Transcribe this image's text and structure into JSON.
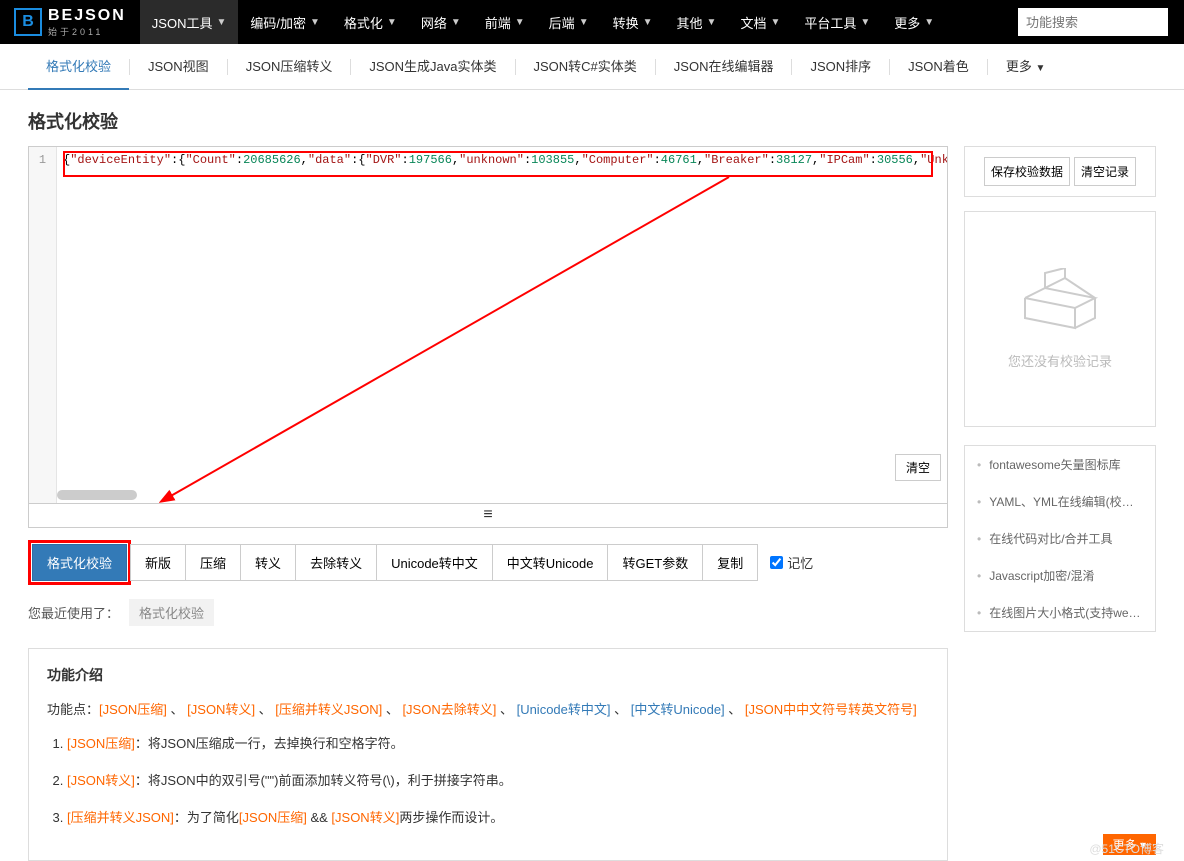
{
  "logo": {
    "letter": "B",
    "name": "BEJSON",
    "sub": "始于2011"
  },
  "nav": [
    "JSON工具",
    "编码/加密",
    "格式化",
    "网络",
    "前端",
    "后端",
    "转换",
    "其他",
    "文档",
    "平台工具",
    "更多"
  ],
  "search": {
    "placeholder": "功能搜索"
  },
  "subnav": [
    "格式化校验",
    "JSON视图",
    "JSON压缩转义",
    "JSON生成Java实体类",
    "JSON转C#实体类",
    "JSON在线编辑器",
    "JSON排序",
    "JSON着色",
    "更多"
  ],
  "title": "格式化校验",
  "editor": {
    "line": "1",
    "code": {
      "t1": "{",
      "k1": "\"deviceEntity\"",
      "t2": ":{",
      "k2": "\"Count\"",
      "t3": ":",
      "n1": "20685626",
      "t4": ",",
      "k3": "\"data\"",
      "t5": ":{",
      "k4": "\"DVR\"",
      "t6": ":",
      "n2": "197566",
      "t7": ",",
      "k5": "\"unknown\"",
      "t8": ":",
      "n3": "103855",
      "t9": ",",
      "k6": "\"Computer\"",
      "t10": ":",
      "n4": "46761",
      "t11": ",",
      "k7": "\"Breaker\"",
      "t12": ":",
      "n5": "38127",
      "t13": ",",
      "k8": "\"IPCam\"",
      "t14": ":",
      "n6": "30556",
      "t15": ",",
      "k9": "\"UnkTyp"
    },
    "clear": "清空",
    "menu_icon": "≡"
  },
  "tools": [
    "格式化校验",
    "新版",
    "压缩",
    "转义",
    "去除转义",
    "Unicode转中文",
    "中文转Unicode",
    "转GET参数",
    "复制"
  ],
  "remember": "记忆",
  "recent": {
    "label": "您最近使用了：",
    "tag": "格式化校验"
  },
  "side": {
    "save": "保存校验数据",
    "clear": "清空记录",
    "empty": "您还没有校验记录",
    "links": [
      "fontawesome矢量图标库",
      "YAML、YML在线编辑(校验)器",
      "在线代码对比/合并工具",
      "Javascript加密/混淆",
      "在线图片大小格式(支持webp..."
    ]
  },
  "intro": {
    "heading": "功能介绍",
    "fn_label": "功能点：",
    "fn_links": [
      "[JSON压缩]",
      "[JSON转义]",
      "[压缩并转义JSON]",
      "[JSON去除转义]",
      "[Unicode转中文]",
      "[中文转Unicode]",
      "[JSON中中文符号转英文符号]"
    ],
    "steps": [
      {
        "a": "[JSON压缩]",
        "t": "：将JSON压缩成一行，去掉换行和空格字符。"
      },
      {
        "a": "[JSON转义]",
        "t": "：将JSON中的双引号(\"\")前面添加转义符号(\\)，利于拼接字符串。"
      },
      {
        "a": "[压缩并转义JSON]",
        "t1": "：为了简化",
        "a2": "[JSON压缩]",
        "t2": " && ",
        "a3": "[JSON转义]",
        "t3": "两步操作而设计。"
      }
    ],
    "more": "更多"
  },
  "watermark": "@51CTO博客"
}
